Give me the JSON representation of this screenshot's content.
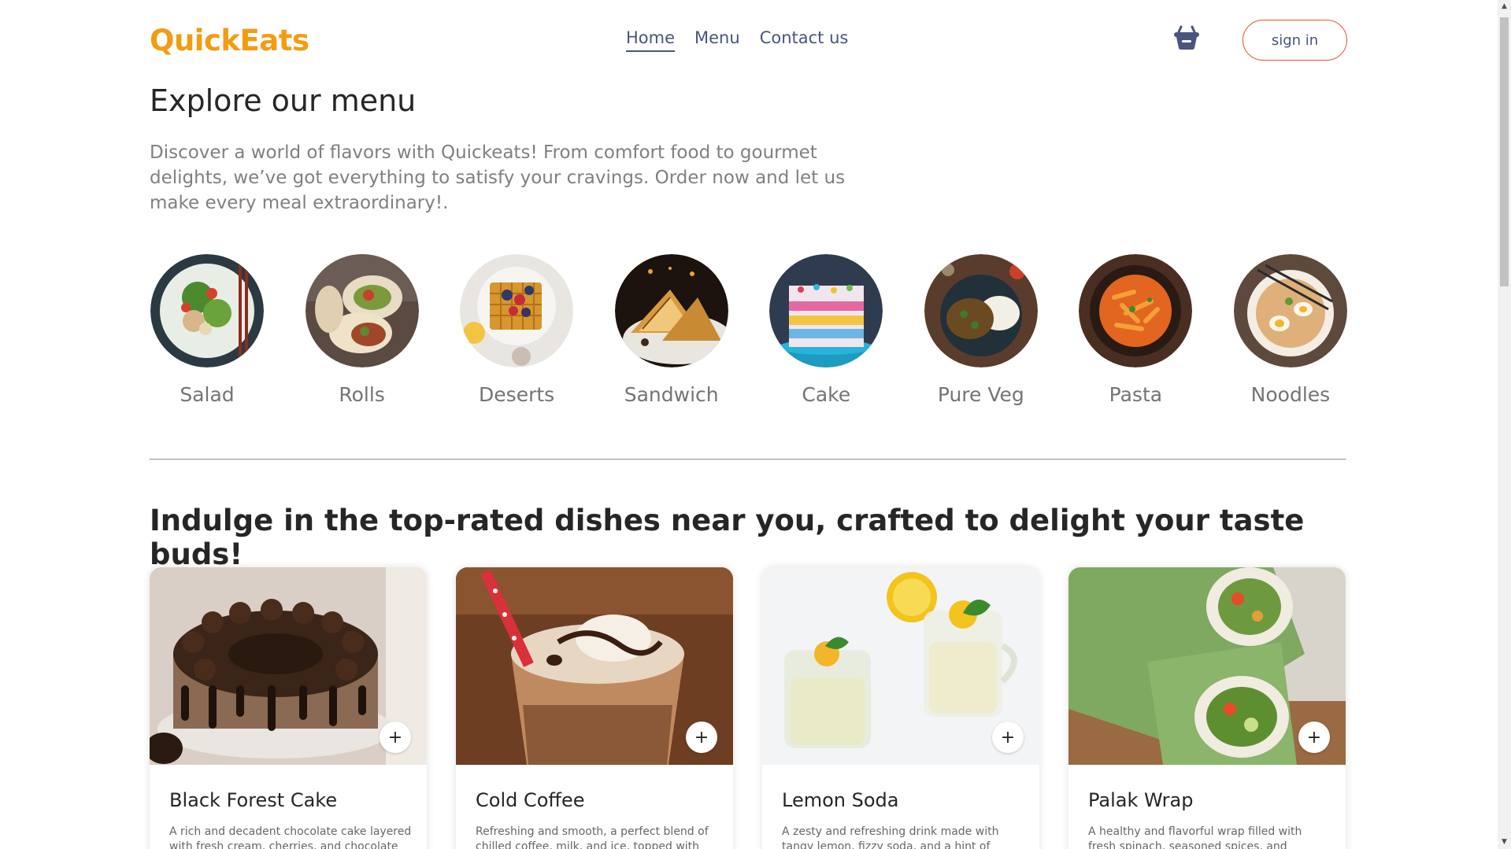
{
  "header": {
    "logo": "QuickEats",
    "nav": [
      {
        "label": "Home",
        "active": true
      },
      {
        "label": "Menu",
        "active": false
      },
      {
        "label": "Contact us",
        "active": false
      }
    ],
    "basket_icon": "basket-icon",
    "signin_label": "sign in"
  },
  "explore": {
    "title": "Explore our menu",
    "description": "Discover a world of flavors with Quickeats! From comfort food to gourmet delights, we’ve got everything to satisfy your cravings. Order now and let us make every meal extraordinary!.",
    "categories": [
      {
        "label": "Salad"
      },
      {
        "label": "Rolls"
      },
      {
        "label": "Deserts"
      },
      {
        "label": "Sandwich"
      },
      {
        "label": "Cake"
      },
      {
        "label": "Pure Veg"
      },
      {
        "label": "Pasta"
      },
      {
        "label": "Noodles"
      }
    ]
  },
  "top_dishes": {
    "title": "Indulge in the top-rated dishes near you, crafted to delight your taste buds!",
    "add_label": "+",
    "items": [
      {
        "name": "Black Forest Cake",
        "description": "A rich and decadent chocolate cake layered with fresh cream, cherries, and chocolate"
      },
      {
        "name": "Cold Coffee",
        "description": "Refreshing and smooth, a perfect blend of chilled coffee, milk, and ice, topped with"
      },
      {
        "name": "Lemon Soda",
        "description": "A zesty and refreshing drink made with tangy lemon, fizzy soda, and a hint of sweetness."
      },
      {
        "name": "Palak Wrap",
        "description": "A healthy and flavorful wrap filled with fresh spinach, seasoned spices, and wrapped in a"
      }
    ]
  },
  "colors": {
    "brand": "#f39c12",
    "nav_text": "#49557e",
    "signin_border": "#e8542f"
  }
}
